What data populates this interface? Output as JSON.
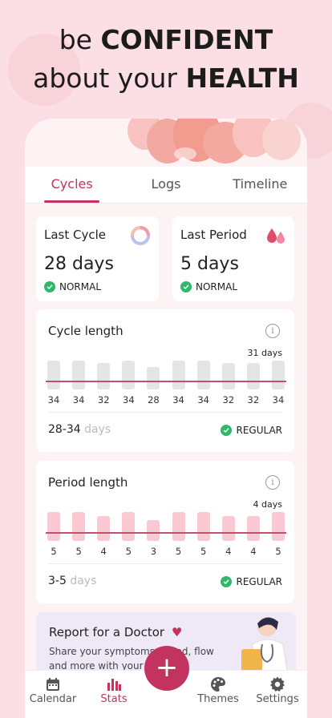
{
  "headline": {
    "line1_normal": "be",
    "line1_bold": "CONFIDENT",
    "line2_normal": "about your",
    "line2_bold": "HEALTH"
  },
  "tabs": [
    {
      "label": "Cycles",
      "active": true
    },
    {
      "label": "Logs",
      "active": false
    },
    {
      "label": "Timeline",
      "active": false
    }
  ],
  "last_cycle": {
    "title": "Last Cycle",
    "value": "28 days",
    "status": "NORMAL"
  },
  "last_period": {
    "title": "Last Period",
    "value": "5 days",
    "status": "NORMAL"
  },
  "cycle_length": {
    "title": "Cycle length",
    "top_label": "31 days",
    "values": [
      34,
      34,
      32,
      34,
      28,
      34,
      34,
      32,
      32,
      34
    ],
    "range": "28-34",
    "unit": "days",
    "status": "REGULAR",
    "bar_color": "#e5e5e5"
  },
  "period_length": {
    "title": "Period length",
    "top_label": "4 days",
    "values": [
      5,
      5,
      4,
      5,
      3,
      5,
      5,
      4,
      4,
      5
    ],
    "range": "3-5",
    "unit": "days",
    "status": "REGULAR",
    "bar_color": "#fac9d3"
  },
  "report": {
    "title": "Report for a Doctor",
    "text": "Share your symptoms, mood, flow and more with your doctor"
  },
  "nav": [
    {
      "label": "Calendar",
      "icon": "calendar-icon",
      "active": false
    },
    {
      "label": "Stats",
      "icon": "stats-icon",
      "active": true
    },
    {
      "label": "Themes",
      "icon": "palette-icon",
      "active": false
    },
    {
      "label": "Settings",
      "icon": "gear-icon",
      "active": false
    }
  ],
  "colors": {
    "accent": "#c2335f",
    "success": "#2fb86a",
    "background": "#fcdfe4"
  },
  "fab_label": "+"
}
